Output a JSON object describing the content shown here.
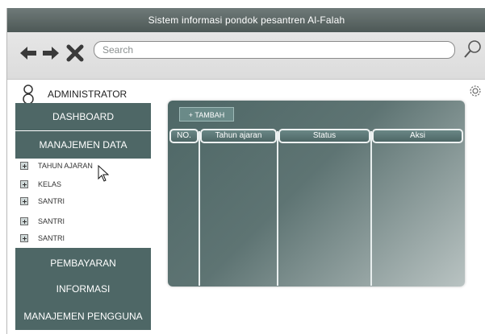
{
  "window": {
    "title": "Sistem informasi pondok pesantren Al-Falah"
  },
  "toolbar": {
    "back_icon": "arrow-left-icon",
    "forward_icon": "arrow-right-icon",
    "close_icon": "close-icon",
    "search_placeholder": "Search",
    "search_icon": "magnifier-icon"
  },
  "user": {
    "label": "ADMINISTRATOR",
    "icon": "user-icon",
    "settings_icon": "gear-icon"
  },
  "sidebar": {
    "top_items": [
      {
        "label": "DASHBOARD"
      },
      {
        "label": "MANAJEMEN DATA"
      }
    ],
    "tree": [
      {
        "label": "TAHUN AJARAN"
      },
      {
        "label": "KELAS"
      },
      {
        "label": "SANTRI"
      },
      {
        "label": "SANTRI"
      },
      {
        "label": "SANTRI"
      }
    ],
    "bottom_items": [
      {
        "label": "PEMBAYARAN"
      },
      {
        "label": "INFORMASI"
      },
      {
        "label": "MANAJEMEN PENGGUNA"
      }
    ]
  },
  "main": {
    "add_label": "+ TAMBAH",
    "columns": [
      {
        "label": "NO."
      },
      {
        "label": "Tahun ajaran"
      },
      {
        "label": "Status"
      },
      {
        "label": "Aksi"
      }
    ]
  },
  "colors": {
    "accent": "#4e6766",
    "titlebar": "#5a6665"
  }
}
